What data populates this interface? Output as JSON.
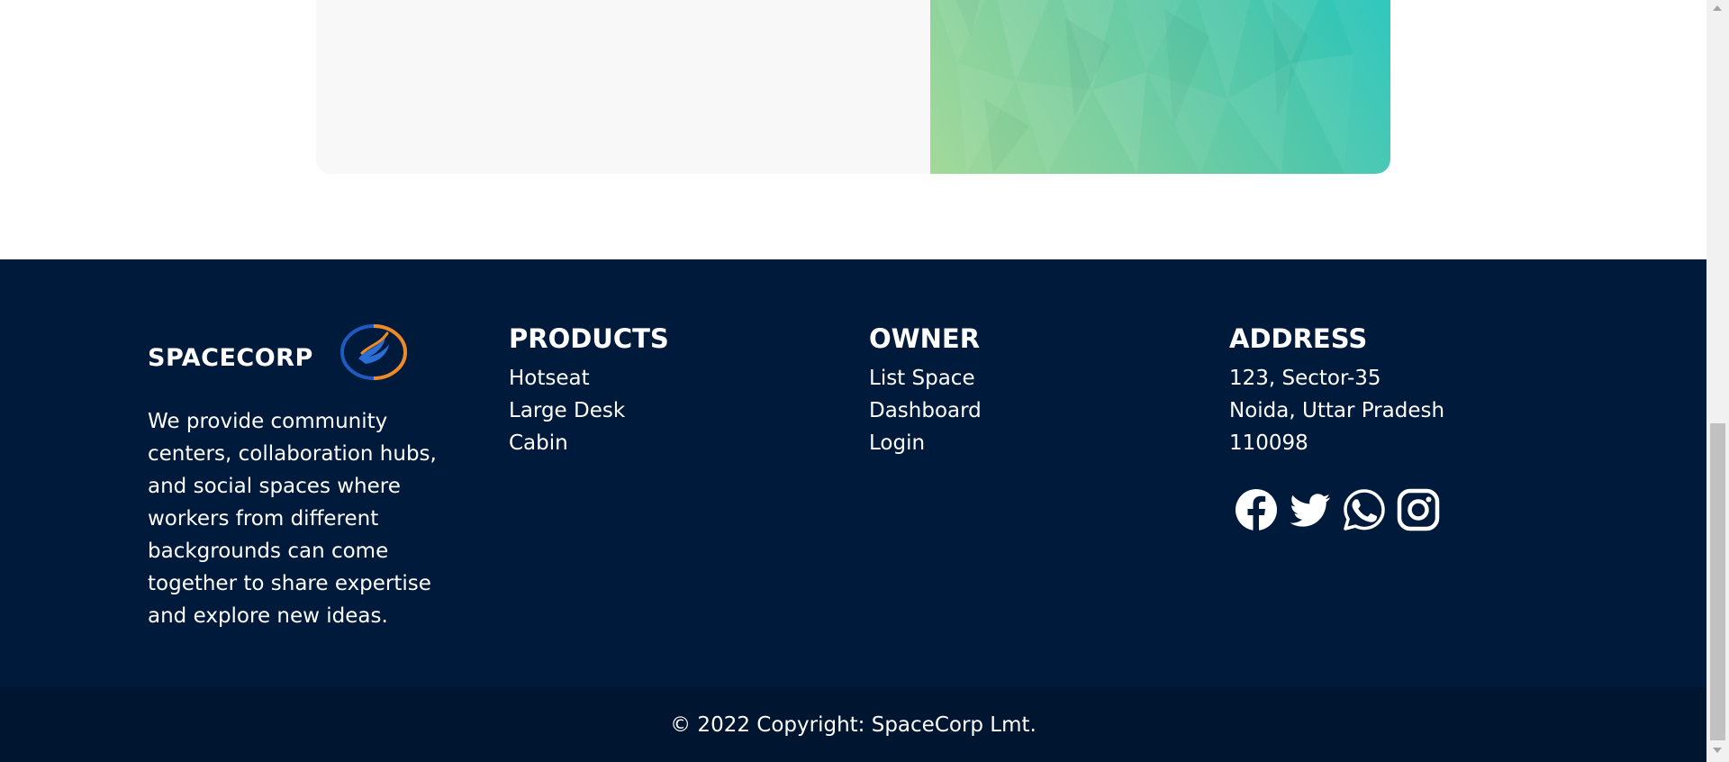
{
  "brand": {
    "name": "SPACECORP",
    "description": "We provide community centers, collaboration hubs, and social spaces where workers from different backgrounds can come together to share expertise and explore new ideas."
  },
  "products": {
    "title": "PRODUCTS",
    "items": [
      "Hotseat",
      "Large Desk",
      "Cabin"
    ]
  },
  "owner": {
    "title": "OWNER",
    "items": [
      "List Space",
      "Dashboard",
      "Login"
    ]
  },
  "address": {
    "title": "ADDRESS",
    "lines": [
      "123, Sector-35",
      "Noida, Uttar Pradesh",
      "110098"
    ]
  },
  "socials": [
    "facebook-icon",
    "twitter-icon",
    "whatsapp-icon",
    "instagram-icon"
  ],
  "copyright": "© 2022 Copyright: SpaceCorp Lmt.",
  "colors": {
    "footer_bg": "#001a3b",
    "copyright_bg": "#00152f",
    "text": "#ffffff",
    "card_bg": "#f8f8f8",
    "accent_teal": "#22c6bd",
    "accent_green": "#a3d99a"
  }
}
